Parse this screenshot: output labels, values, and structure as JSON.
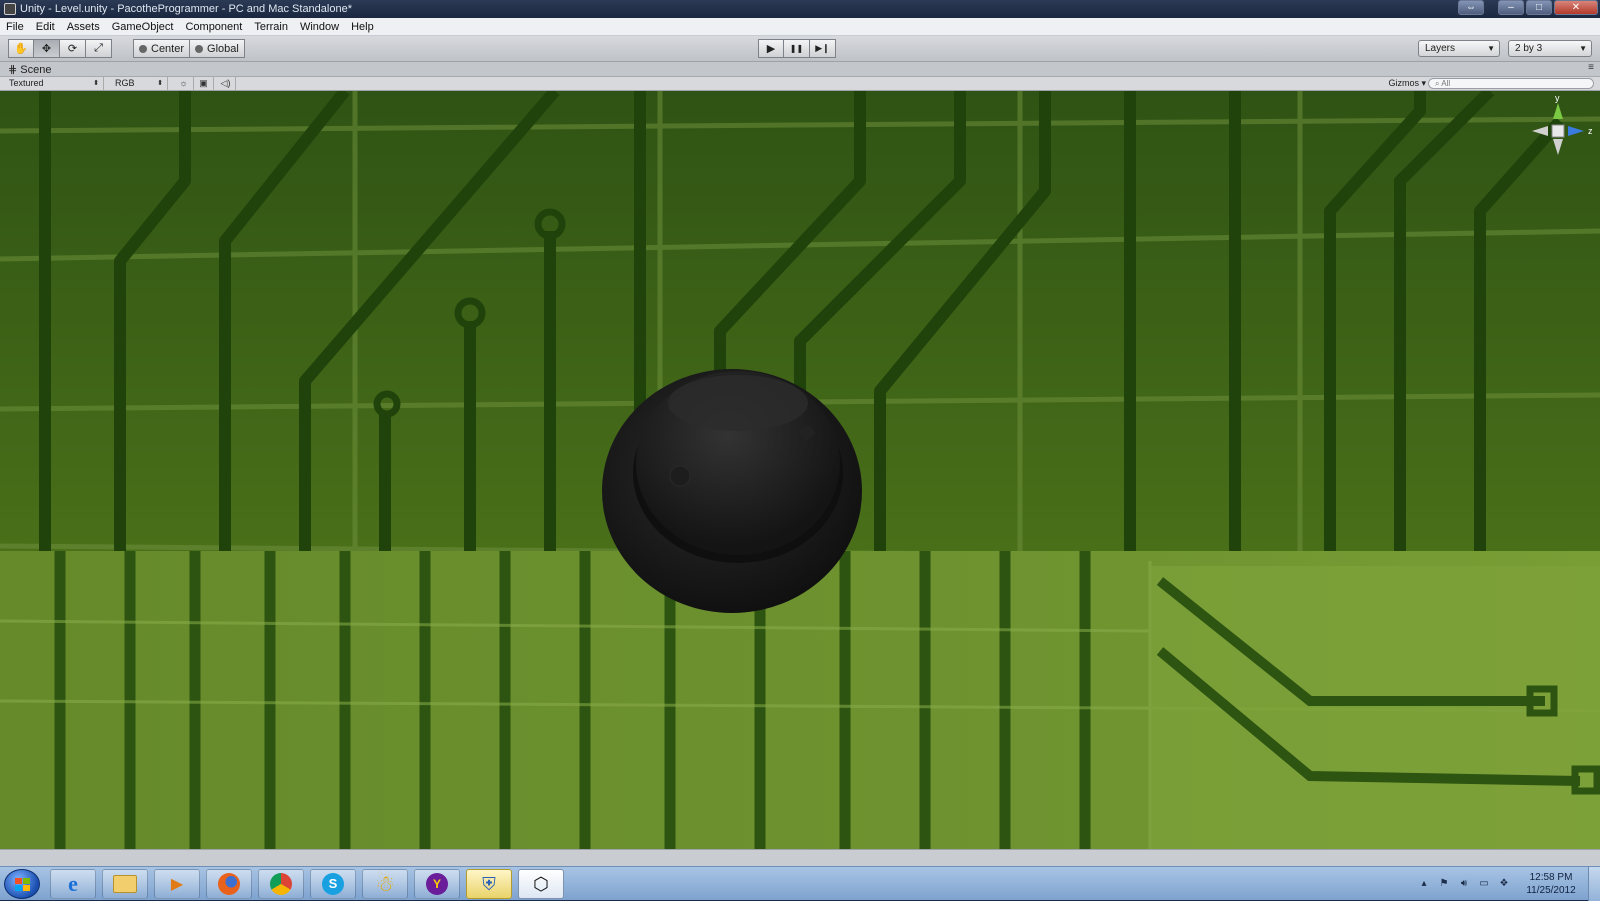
{
  "window": {
    "title": "Unity - Level.unity - PacotheProgrammer - PC and Mac Standalone*",
    "minimize": "–",
    "maximize": "□",
    "close": "✕",
    "extra": "⇔"
  },
  "menu": [
    "File",
    "Edit",
    "Assets",
    "GameObject",
    "Component",
    "Terrain",
    "Window",
    "Help"
  ],
  "toolbar": {
    "tools": [
      {
        "name": "hand-tool",
        "icon": "✋"
      },
      {
        "name": "move-tool",
        "icon": "✥"
      },
      {
        "name": "rotate-tool",
        "icon": "⟳"
      },
      {
        "name": "scale-tool",
        "icon": "⤢"
      }
    ],
    "pivot_label": "Center",
    "space_label": "Global",
    "play": "▶",
    "pause": "❚❚",
    "step": "▶❙",
    "layers_label": "Layers",
    "layout_label": "2 by 3"
  },
  "scene": {
    "tab_label": "Scene",
    "render_mode": "Textured",
    "channel": "RGB",
    "gizmos_label": "Gizmos",
    "search_placeholder": "All",
    "axis_y": "y",
    "axis_z": "z"
  },
  "taskbar": {
    "time": "12:58 PM",
    "date": "11/25/2012"
  },
  "colors": {
    "board_top": "#3f6a1a",
    "board_bottom": "#6e8f2a",
    "trace": "#22480c",
    "object": "#1a1a1a"
  }
}
